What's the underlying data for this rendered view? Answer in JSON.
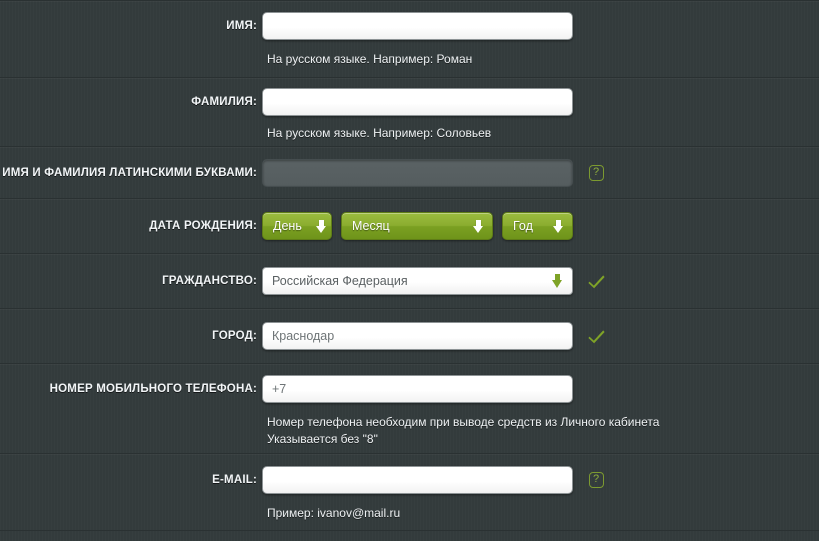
{
  "form": {
    "colors": {
      "background": "#343c3d",
      "divider": "#2a3132",
      "accent_green": "#8bad2f",
      "green_dark": "#6f941a",
      "check_green": "#7fa327",
      "input_white": "#ffffff",
      "input_disabled": "#5a6264",
      "label_text": "#f2f5f7",
      "hint_text": "#eef1f3",
      "placeholder_text": "#6e7476"
    },
    "rows": {
      "first_name": {
        "label": "ИМЯ:",
        "value": "",
        "placeholder": "",
        "hint": "На русском языке. Например: Роман"
      },
      "last_name": {
        "label": "ФАМИЛИЯ:",
        "value": "",
        "placeholder": "",
        "hint": "На русском языке. Например: Соловьев"
      },
      "latin_name": {
        "label": "ИМЯ И ФАМИЛИЯ ЛАТИНСКИМИ БУКВАМИ:",
        "value": "",
        "placeholder": "",
        "help_icon": "question-mark-icon",
        "help_glyph": "?"
      },
      "birth_date": {
        "label": "ДАТА РОЖДЕНИЯ:",
        "day": {
          "label": "День",
          "icon": "arrow-down-icon"
        },
        "month": {
          "label": "Месяц",
          "icon": "arrow-down-icon"
        },
        "year": {
          "label": "Год",
          "icon": "arrow-down-icon"
        }
      },
      "citizenship": {
        "label": "ГРАЖДАНСТВО:",
        "value": "Российская Федерация",
        "icon": "arrow-down-icon",
        "status_icon": "checkmark-icon"
      },
      "city": {
        "label": "ГОРОД:",
        "value": "Краснодар",
        "placeholder": "Краснодар",
        "status_icon": "checkmark-icon"
      },
      "phone": {
        "label": "НОМЕР МОБИЛЬНОГО ТЕЛЕФОНА:",
        "value": "+7",
        "placeholder": "+7",
        "hint_line_1": "Номер телефона необходим при выводе средств из Личного кабинета",
        "hint_line_2": "Указывается без \"8\""
      },
      "email": {
        "label": "E-MAIL:",
        "value": "",
        "placeholder": "",
        "help_icon": "question-mark-icon",
        "help_glyph": "?",
        "hint": "Пример: ivanov@mail.ru"
      }
    }
  }
}
